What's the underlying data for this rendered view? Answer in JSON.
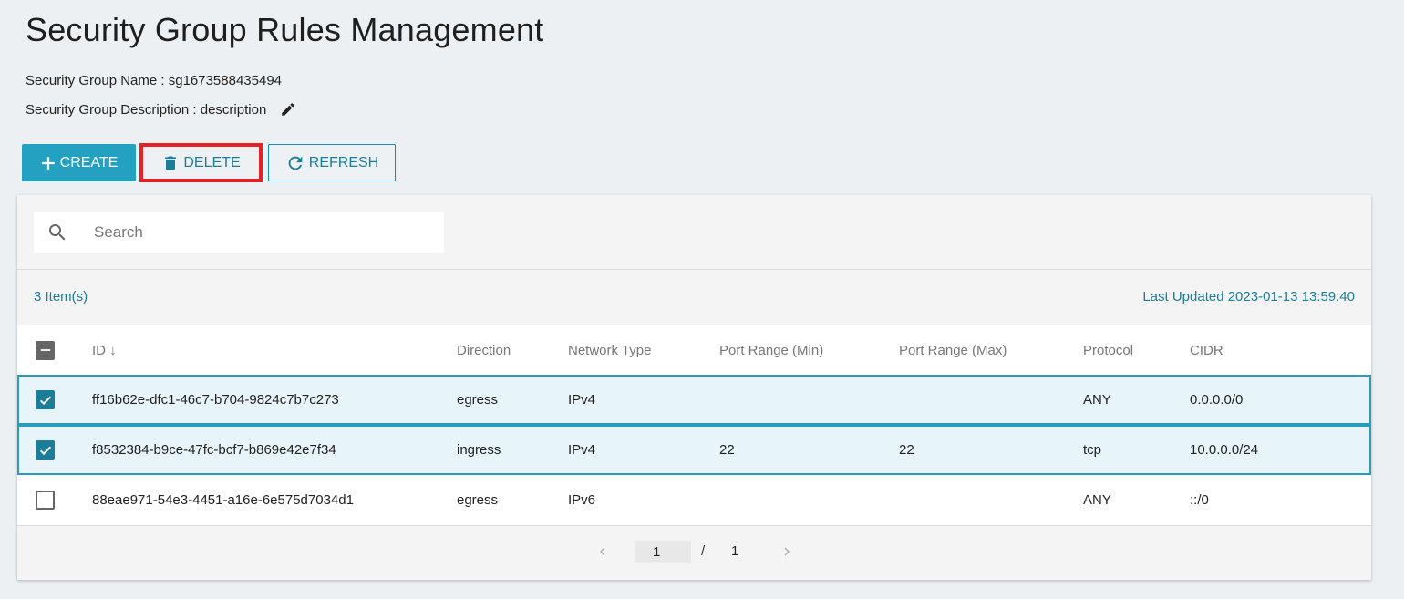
{
  "page": {
    "title": "Security Group Rules Management",
    "group_name_line": "Security Group Name : sg1673588435494",
    "group_desc_line": "Security Group Description : description"
  },
  "toolbar": {
    "create_label": "CREATE",
    "delete_label": "DELETE",
    "refresh_label": "REFRESH"
  },
  "search": {
    "placeholder": "Search",
    "value": ""
  },
  "summary": {
    "count": "3 Item(s)",
    "last_updated": "Last Updated 2023-01-13 13:59:40"
  },
  "table": {
    "columns": [
      "ID ↓",
      "Direction",
      "Network Type",
      "Port Range (Min)",
      "Port Range (Max)",
      "Protocol",
      "CIDR"
    ],
    "rows": [
      {
        "id": "ff16b62e-dfc1-46c7-b704-9824c7b7c273",
        "direction": "egress",
        "network_type": "IPv4",
        "port_min": "",
        "port_max": "",
        "protocol": "ANY",
        "cidr": "0.0.0.0/0",
        "selected": true
      },
      {
        "id": "f8532384-b9ce-47fc-bcf7-b869e42e7f34",
        "direction": "ingress",
        "network_type": "IPv4",
        "port_min": "22",
        "port_max": "22",
        "protocol": "tcp",
        "cidr": "10.0.0.0/24",
        "selected": true
      },
      {
        "id": "88eae971-54e3-4451-a16e-6e575d7034d1",
        "direction": "egress",
        "network_type": "IPv6",
        "port_min": "",
        "port_max": "",
        "protocol": "ANY",
        "cidr": "::/0",
        "selected": false
      }
    ]
  },
  "pagination": {
    "current": "1",
    "separator": "/",
    "total": "1"
  },
  "colors": {
    "accent": "#24a1c0",
    "link": "#1b7d97",
    "highlight": "#e62128",
    "selected_row": "#e7f5fa"
  }
}
